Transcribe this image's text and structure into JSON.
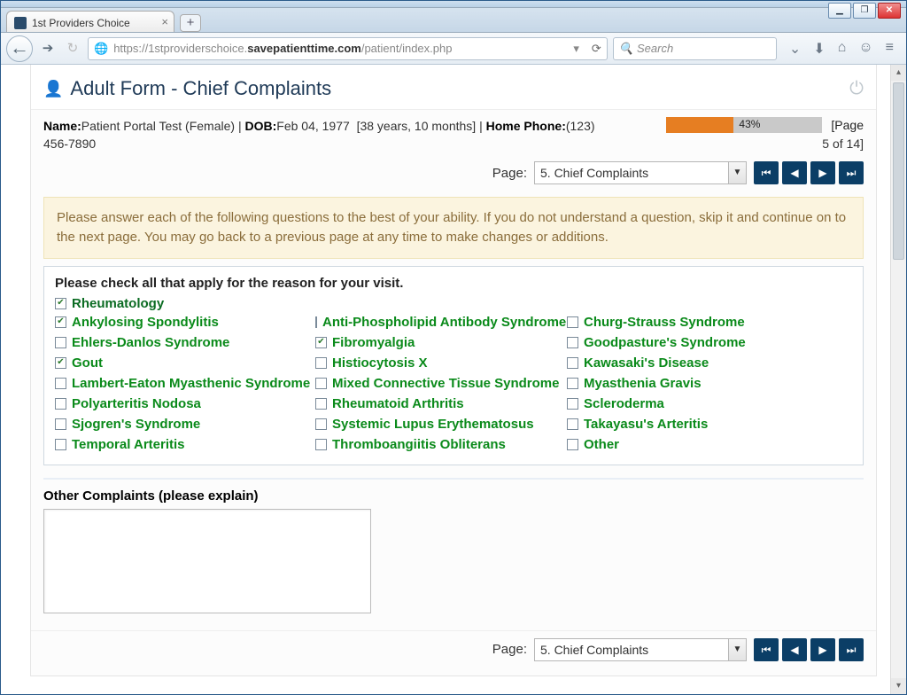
{
  "browser": {
    "tab_title": "1st Providers Choice",
    "url_prefix": "https://1stproviderschoice.",
    "url_bold": "savepatienttime.com",
    "url_suffix": "/patient/index.php",
    "search_placeholder": "Search"
  },
  "header": {
    "title": "Adult Form - Chief Complaints"
  },
  "patient": {
    "name_label": "Name:",
    "name_value": "Patient Portal Test (Female)",
    "dob_label": "DOB:",
    "dob_value": "Feb 04, 1977",
    "age": "[38 years, 10 months]",
    "phone_label": "Home Phone:",
    "phone_value": "(123)",
    "phone_line2": "456-7890"
  },
  "progress": {
    "percent_text": "43%",
    "percent_value": 43,
    "page_label_a": "[Page",
    "page_label_b": "5 of 14]"
  },
  "pager": {
    "label": "Page:",
    "selected": "5. Chief Complaints"
  },
  "notice": "Please answer each of the following questions to the best of your ability. If you do not understand a question, skip it and continue on to the next page. You may go back to a previous page at any time to make changes or additions.",
  "form": {
    "prompt": "Please check all that apply for the reason for your visit.",
    "category": {
      "label": "Rheumatology",
      "checked": true
    },
    "options": [
      {
        "label": "Ankylosing Spondylitis",
        "checked": true
      },
      {
        "label": "Anti-Phospholipid Antibody Syndrome",
        "checked": false
      },
      {
        "label": "Churg-Strauss Syndrome",
        "checked": false
      },
      {
        "label": "Ehlers-Danlos Syndrome",
        "checked": false
      },
      {
        "label": "Fibromyalgia",
        "checked": true
      },
      {
        "label": "Goodpasture's Syndrome",
        "checked": false
      },
      {
        "label": "Gout",
        "checked": true
      },
      {
        "label": "Histiocytosis X",
        "checked": false
      },
      {
        "label": "Kawasaki's Disease",
        "checked": false
      },
      {
        "label": "Lambert-Eaton Myasthenic Syndrome",
        "checked": false
      },
      {
        "label": "Mixed Connective Tissue Syndrome",
        "checked": false
      },
      {
        "label": "Myasthenia Gravis",
        "checked": false
      },
      {
        "label": "Polyarteritis Nodosa",
        "checked": false
      },
      {
        "label": "Rheumatoid Arthritis",
        "checked": false
      },
      {
        "label": "Scleroderma",
        "checked": false
      },
      {
        "label": "Sjogren's Syndrome",
        "checked": false
      },
      {
        "label": "Systemic Lupus Erythematosus",
        "checked": false
      },
      {
        "label": "Takayasu's Arteritis",
        "checked": false
      },
      {
        "label": "Temporal Arteritis",
        "checked": false
      },
      {
        "label": "Thromboangiitis Obliterans",
        "checked": false
      },
      {
        "label": "Other",
        "checked": false
      }
    ],
    "other_label": "Other Complaints (please explain)",
    "other_value": ""
  }
}
